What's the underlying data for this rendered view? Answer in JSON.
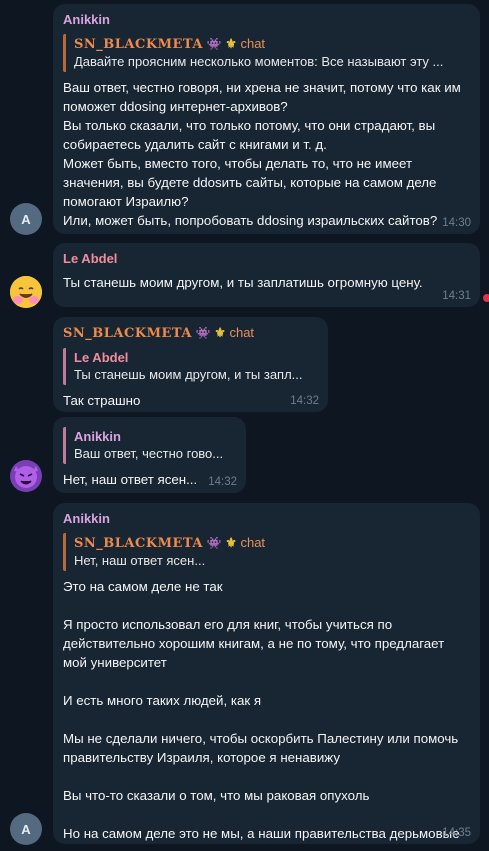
{
  "messages": {
    "m1": {
      "sender": "Anikkin",
      "reply_title": "SN_BLACKMETA",
      "reply_tag": "chat",
      "reply_text": "Давайте проясним несколько моментов:   Все называют эту ...",
      "text": "Ваш ответ, честно говоря, ни хрена не значит, потому что как им поможет ddosing интернет-архивов?\nВы только сказали, что только потому, что они страдают, вы собираетесь удалить сайт с книгами и т. д.\nМожет быть, вместо того, чтобы делать то, что не имеет значения, вы будете ddosить сайты, которые на самом деле помогают Израилю?\nИли, может быть, попробовать ddosing израильских сайтов?",
      "time": "14:30"
    },
    "m2": {
      "sender": "Le Abdel",
      "text": "Ты станешь моим другом, и ты заплатишь огромную цену.",
      "time": "14:31"
    },
    "m3": {
      "sender": "SN_BLACKMETA",
      "sender_tag": "chat",
      "reply_title": "Le Abdel",
      "reply_text": "Ты станешь моим другом, и ты запл...",
      "text": "Так страшно",
      "time": "14:32"
    },
    "m4": {
      "reply_title": "Anikkin",
      "reply_text": "Ваш ответ, честно гово...",
      "text": "Нет, наш ответ ясен...",
      "time": "14:32"
    },
    "m5": {
      "sender": "Anikkin",
      "reply_title": "SN_BLACKMETA",
      "reply_tag": "chat",
      "reply_text": "Нет, наш ответ ясен...",
      "text": "Это на самом деле не так\n\nЯ просто использовал его для книг, чтобы учиться по действительно хорошим книгам, а не по тому, что предлагает мой университет\n\nИ есть много таких людей, как я\n\nМы не сделали ничего, чтобы оскорбить Палестину или помочь правительству Израиля, которое я ненавижу\n\nВы что-то сказали о том, что мы раковая опухоль\n\nНо на самом деле это не мы, а наши правительства дерьмовые",
      "time": "14:35"
    }
  },
  "avatars": {
    "anikkin_letter": "A",
    "leabdel_icon": "hugging-face-emoji",
    "blackmeta_icon": "devil-face-emoji"
  },
  "colors": {
    "background": "#0e1621",
    "bubble": "#182533",
    "anikkin_name": "#d9a3e0",
    "leabdel_name": "#f08e9e",
    "blackmeta_name": "#f08a4b"
  }
}
